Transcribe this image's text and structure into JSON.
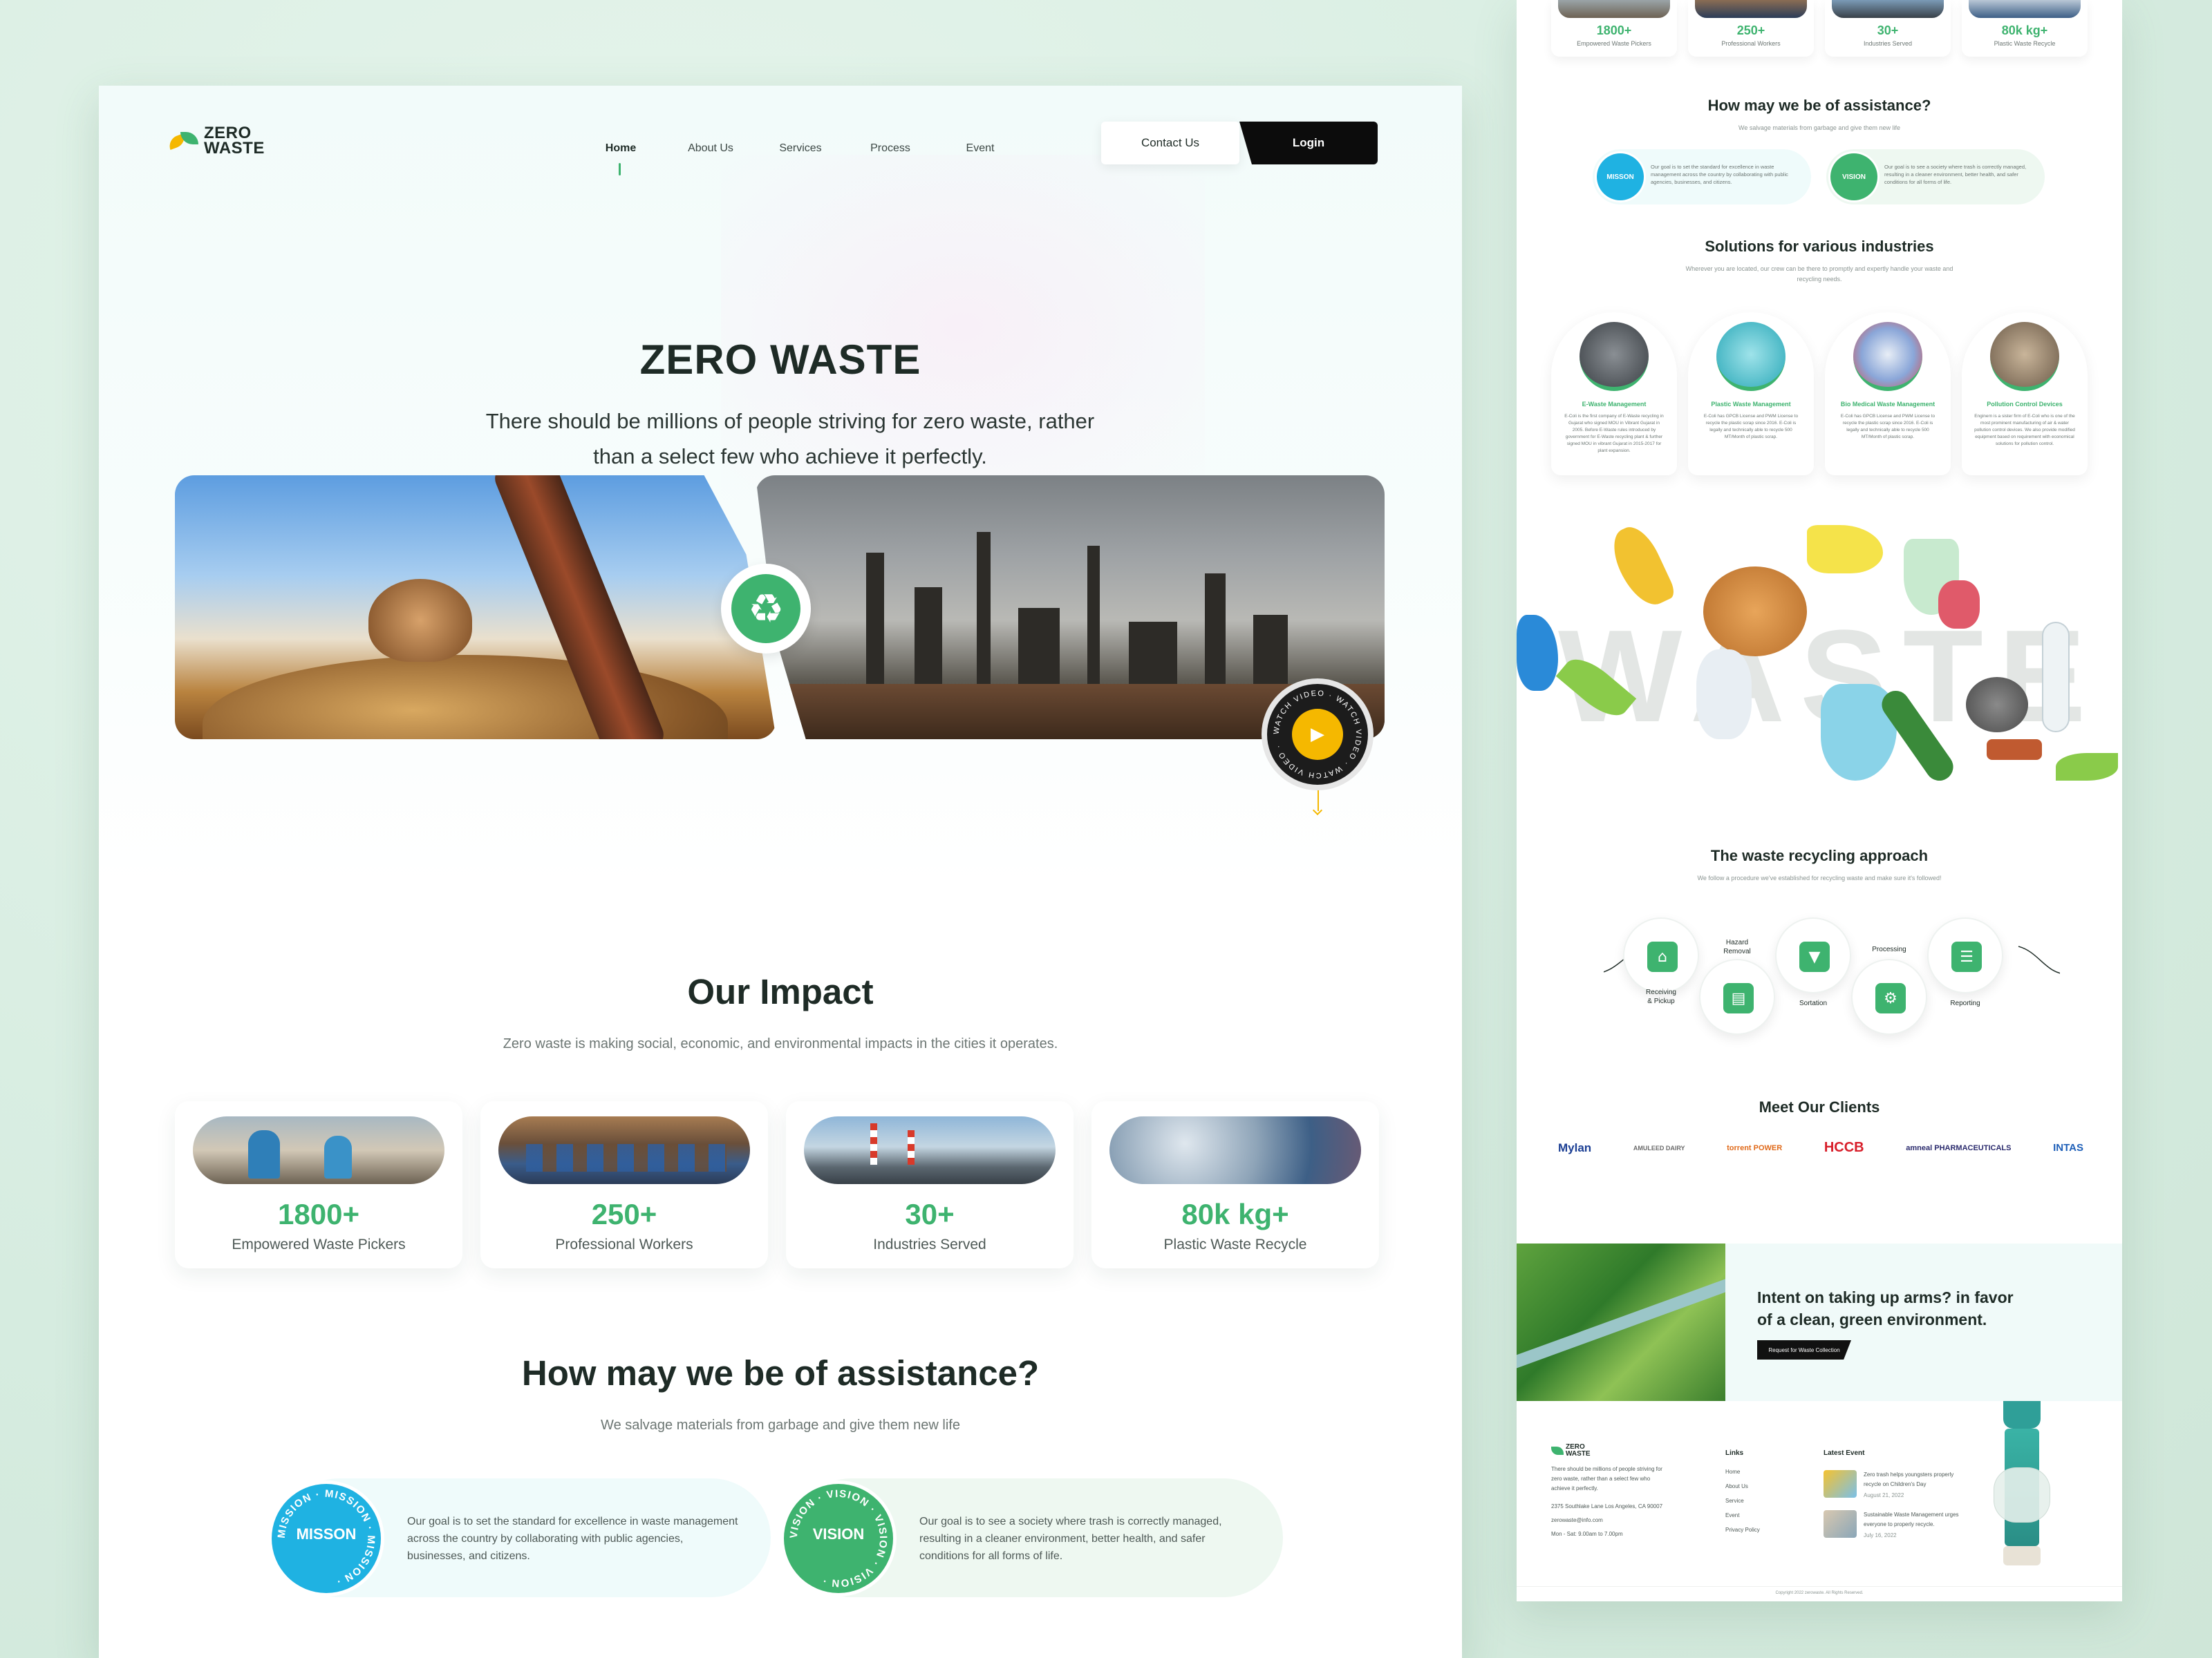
{
  "brand": {
    "name_line1": "ZERO",
    "name_line2": "WASTE"
  },
  "nav": {
    "links": [
      "Home",
      "About Us",
      "Services",
      "Process",
      "Event"
    ],
    "active": "Home",
    "contact_label": "Contact Us",
    "login_label": "Login"
  },
  "hero": {
    "title": "ZERO WASTE",
    "subtitle_line1": "There should be millions of people striving for zero waste, rather",
    "subtitle_line2": "than a select few who achieve it perfectly.",
    "watch_text": "WATCH VIDEO · WATCH VIDEO · WATCH VIDEO ·"
  },
  "impact": {
    "title": "Our Impact",
    "subtitle": "Zero waste is making social, economic, and environmental impacts in the cities it operates.",
    "cards": [
      {
        "value": "1800+",
        "label": "Empowered Waste Pickers"
      },
      {
        "value": "250+",
        "label": "Professional Workers"
      },
      {
        "value": "30+",
        "label": "Industries Served"
      },
      {
        "value": "80k kg+",
        "label": "Plastic Waste Recycle"
      }
    ]
  },
  "assistance": {
    "title": "How may we be of assistance?",
    "subtitle": "We salvage materials from garbage and give them new life",
    "mission": {
      "seal": "MISSON",
      "ring": "MISSION · MISSION · MISSION ·",
      "text": "Our goal is to set the standard for excellence in waste management across the country by collaborating with public agencies, businesses, and citizens."
    },
    "vision": {
      "seal": "VISION",
      "ring": "VISION · VISION · VISION · VISION ·",
      "text": "Our goal is to see a society where trash is correctly managed, resulting in a cleaner environment, better health, and safer conditions for all forms of life."
    }
  },
  "solutions": {
    "title": "Solutions for various industries",
    "subtitle": "Wherever you are located, our crew can be there to promptly and expertly handle your waste and recycling needs.",
    "items": [
      {
        "title": "E-Waste Management",
        "text": "E-Coli is the first company of E-Waste recycling in Gujarat who signed MOU in Vibrant Gujarat in 2005. Before E-Waste rules introduced by government for E-Waste recycling plant & further signed MOU in vibrant Gujarat in 2015-2017 for plant expansion."
      },
      {
        "title": "Plastic Waste Management",
        "text": "E-Coli has GPCB License and PWM License to recycle the plastic scrap since 2016. E-Coli is legally and technically able to recycle 500 MT/Month of plastic scrap."
      },
      {
        "title": "Bio Medical Waste Management",
        "text": "E-Coli has GPCB License and PWM License to recycle the plastic scrap since 2016. E-Coli is legally and technically able to recycle 500 MT/Month of plastic scrap."
      },
      {
        "title": "Pollution Control Devices",
        "text": "Enginern is a sister firm of E-Coli who is one of the most prominent manufacturing of air & water pollution control devices. We also provide modified equipment based on requirement with economical solutions for pollution control."
      }
    ]
  },
  "waste_art": {
    "word": "WASTE"
  },
  "process": {
    "title": "The waste recycling approach",
    "subtitle": "We follow a procedure we've established for recycling waste and make sure it's followed!",
    "steps": [
      {
        "label_line1": "Receiving",
        "label_line2": "& Pickup"
      },
      {
        "label_line1": "Hazard",
        "label_line2": "Removal"
      },
      {
        "label_line1": "Sortation",
        "label_line2": ""
      },
      {
        "label_line1": "Processing",
        "label_line2": ""
      },
      {
        "label_line1": "Reporting",
        "label_line2": ""
      }
    ]
  },
  "clients": {
    "title": "Meet Our Clients",
    "logos": [
      "Mylan",
      "AMULEED DAIRY",
      "torrent POWER",
      "HCCB",
      "amneal PHARMACEUTICALS",
      "INTAS"
    ]
  },
  "cta": {
    "text_line1": "Intent on taking up arms? in favor",
    "text_line2": "of a clean, green environment.",
    "button": "Request for Waste Collection"
  },
  "footer": {
    "about": "There should be millions of people striving for zero waste, rather than a select few who achieve it perfectly.",
    "address": "2375 Southlake Lane Los Angeles, CA 90007",
    "email": "zerowaste@info.com",
    "hours": "Mon - Sat: 9.00am to 7.00pm",
    "links_title": "Links",
    "links": [
      "Home",
      "About Us",
      "Service",
      "Event",
      "Privacy Policy"
    ],
    "events_title": "Latest Event",
    "events": [
      {
        "title": "Zero trash helps youngsters properly recycle on Children's Day",
        "date": "August 21, 2022"
      },
      {
        "title": "Sustainable Waste Management urges everyone to properly recycle.",
        "date": "July 16, 2022"
      }
    ],
    "copyright": "Copyright 2022 zerowaste. All Rights Reserved."
  },
  "colors": {
    "accent_green": "#3eb36f",
    "accent_blue": "#1fb2e2",
    "accent_yellow": "#f5b800",
    "dark": "#1e2b26"
  }
}
